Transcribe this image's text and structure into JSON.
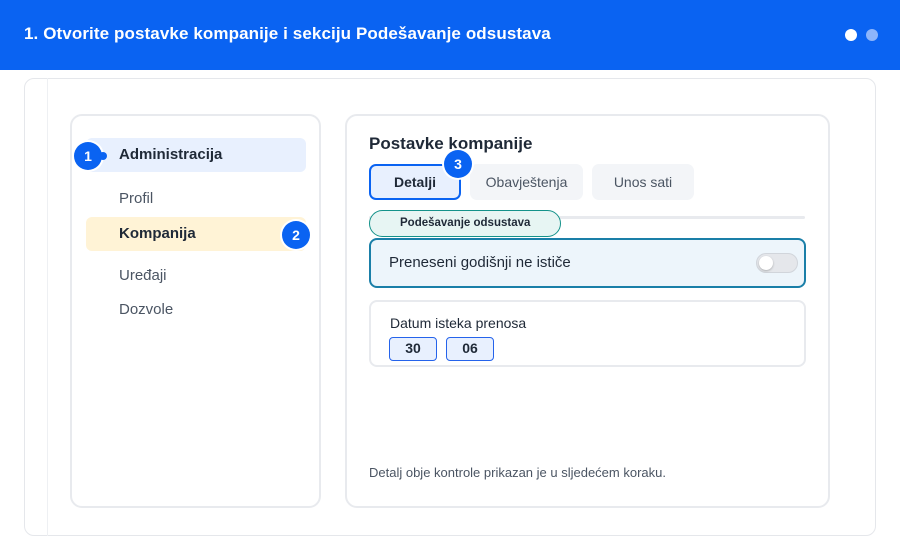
{
  "header": {
    "title": "1. Otvorite postavke kompanije i sekciju Podešavanje odsustava",
    "step_dots": [
      "active",
      "inactive"
    ]
  },
  "sidebar": {
    "items": [
      {
        "label": "Administracija",
        "badge": "1"
      },
      {
        "label": "Profil"
      },
      {
        "label": "Kompanija",
        "badge": "2"
      },
      {
        "label": "Uređaji"
      },
      {
        "label": "Dozvole"
      }
    ]
  },
  "main": {
    "title": "Postavke kompanije",
    "tabs": [
      {
        "label": "Detalji",
        "badge": "3",
        "active": true
      },
      {
        "label": "Obavještenja"
      },
      {
        "label": "Unos sati"
      }
    ],
    "section_label": "Podešavanje odsustava",
    "toggle": {
      "label": "Preneseni godišnji ne ističe",
      "on": false
    },
    "date_field": {
      "label": "Datum isteka prenosa",
      "day": "30",
      "month": "06"
    },
    "footnote": "Detalj obje kontrole prikazan je u sljedećem koraku."
  },
  "colors": {
    "brand": "#0a63f2",
    "highlight_admin": "#e8f0fe",
    "highlight_kompanija": "#fff3d6",
    "section_teal": "#14928a"
  }
}
